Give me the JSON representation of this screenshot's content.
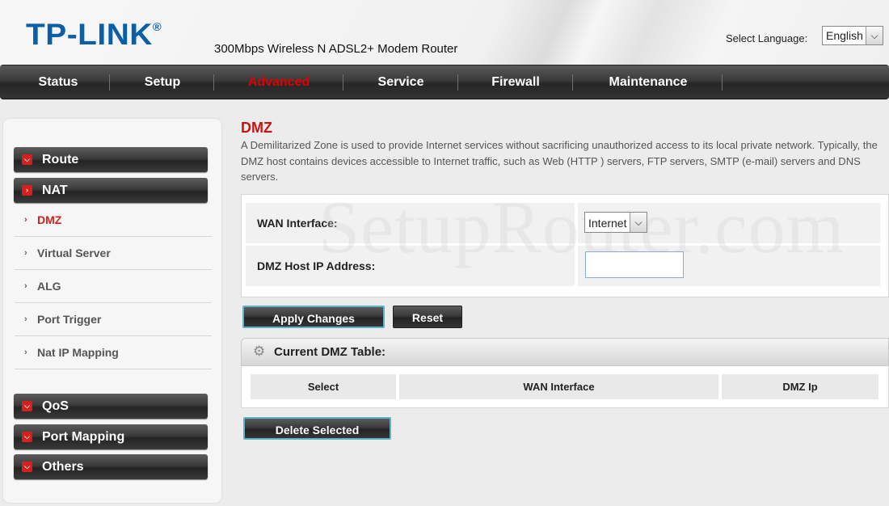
{
  "header": {
    "logo": "TP-LINK",
    "logo_mark": "®",
    "model": "300Mbps Wireless N ADSL2+ Modem Router",
    "language_label": "Select Language:",
    "language_value": "English"
  },
  "topnav": {
    "items": [
      {
        "label": "Status"
      },
      {
        "label": "Setup"
      },
      {
        "label": "Advanced",
        "active": true
      },
      {
        "label": "Service"
      },
      {
        "label": "Firewall"
      },
      {
        "label": "Maintenance"
      }
    ]
  },
  "sidebar": {
    "groups": [
      {
        "label": "Route"
      },
      {
        "label": "NAT"
      },
      {
        "label": "QoS"
      },
      {
        "label": "Port Mapping"
      },
      {
        "label": "Others"
      }
    ],
    "nat_items": [
      {
        "label": "DMZ",
        "active": true
      },
      {
        "label": "Virtual Server"
      },
      {
        "label": "ALG"
      },
      {
        "label": "Port Trigger"
      },
      {
        "label": "Nat IP Mapping"
      }
    ]
  },
  "main": {
    "title": "DMZ",
    "description": "A Demilitarized Zone is used to provide Internet services without sacrificing unauthorized access to its local private network. Typically, the DMZ host contains devices accessible to Internet traffic, such as Web (HTTP ) servers, FTP servers, SMTP (e-mail) servers and DNS servers.",
    "form": {
      "wan_label": "WAN Interface:",
      "wan_value": "Internet",
      "host_ip_label": "DMZ Host IP Address:",
      "host_ip_value": ""
    },
    "buttons": {
      "apply": "Apply Changes",
      "reset": "Reset",
      "delete": "Delete Selected"
    },
    "table": {
      "title": "Current DMZ Table:",
      "columns": [
        "Select",
        "WAN Interface",
        "DMZ Ip"
      ]
    }
  },
  "watermark": "SetupRouter.com",
  "colors": {
    "accent_red": "#cc1111",
    "logo_blue": "#0b5fa8",
    "nav_dark": "#2e2e2e"
  }
}
